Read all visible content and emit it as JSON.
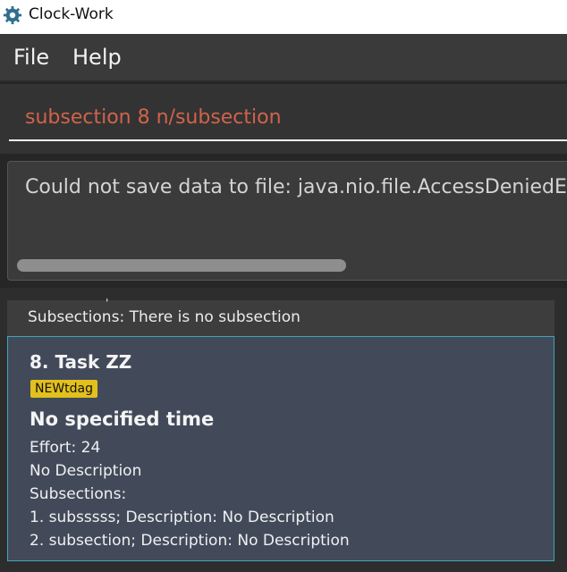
{
  "window": {
    "title": "Clock-Work"
  },
  "menu": {
    "file": "File",
    "help": "Help"
  },
  "command": {
    "value": "subsection 8 n/subsection"
  },
  "result": {
    "text": "Could not save data to file: java.nio.file.AccessDeniedException"
  },
  "prev_card": {
    "subsections": "Subsections: There is no subsection"
  },
  "card": {
    "index_title": "8.  Task ZZ",
    "tag": "NEWtdag",
    "time": "No specified time",
    "effort": "Effort: 24",
    "description": "No Description",
    "subsections_label": "Subsections:",
    "subsection_1": "1. subsssss; Description: No Description",
    "subsection_2": "2. subsection; Description: No Description"
  },
  "colors": {
    "command_text": "#d0634b",
    "tag_bg": "#e3c01c",
    "card_border": "#3fa6b9",
    "card_bg": "#424a5a"
  },
  "icons": {
    "app": "gear-icon"
  }
}
